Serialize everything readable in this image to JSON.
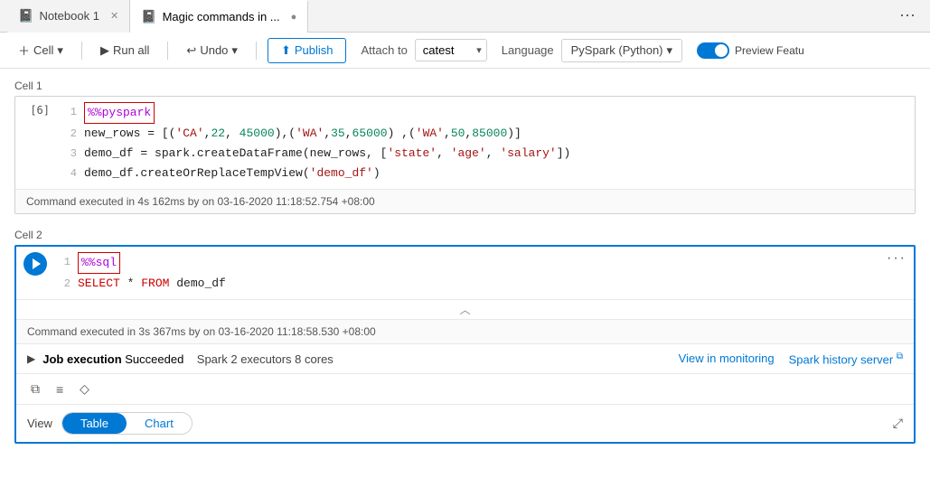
{
  "tabs": [
    {
      "id": "notebook1",
      "label": "Notebook 1",
      "active": false,
      "icon": "📓"
    },
    {
      "id": "magic",
      "label": "Magic commands in ...",
      "active": true,
      "icon": "📓"
    }
  ],
  "toolbar": {
    "cell_label": "Cell",
    "run_all_label": "Run all",
    "undo_label": "Undo",
    "publish_label": "Publish",
    "attach_label": "Attach to",
    "attach_value": "catest",
    "language_label": "Language",
    "language_value": "PySpark (Python)",
    "preview_label": "Preview Featu"
  },
  "cell1": {
    "label": "Cell 1",
    "exec_num": "[6]",
    "lines": [
      {
        "num": "1",
        "code": "%%pyspark",
        "magic": true
      },
      {
        "num": "2",
        "code": "new_rows = [('CA',22, 45000),('WA',35,65000) ,('WA',50,85000)]"
      },
      {
        "num": "3",
        "code": "demo_df = spark.createDataFrame(new_rows, ['state', 'age', 'salary'])"
      },
      {
        "num": "4",
        "code": "demo_df.createOrReplaceTempView('demo_df')"
      }
    ],
    "status": "Command executed in 4s 162ms by    on 03-16-2020 11:18:52.754 +08:00"
  },
  "cell2": {
    "label": "Cell 2",
    "lines": [
      {
        "num": "1",
        "code": "%%sql",
        "magic": true
      },
      {
        "num": "2",
        "code": "SELECT * FROM demo_df"
      }
    ],
    "status": "Command executed in 3s 367ms by    on 03-16-2020 11:18:58.530 +08:00",
    "job": {
      "status": "Succeeded",
      "spark_info": "Spark 2 executors 8 cores",
      "view_monitoring": "View in monitoring",
      "spark_history": "Spark history server"
    },
    "view_label": "View",
    "view_table": "Table",
    "view_chart": "Chart"
  }
}
